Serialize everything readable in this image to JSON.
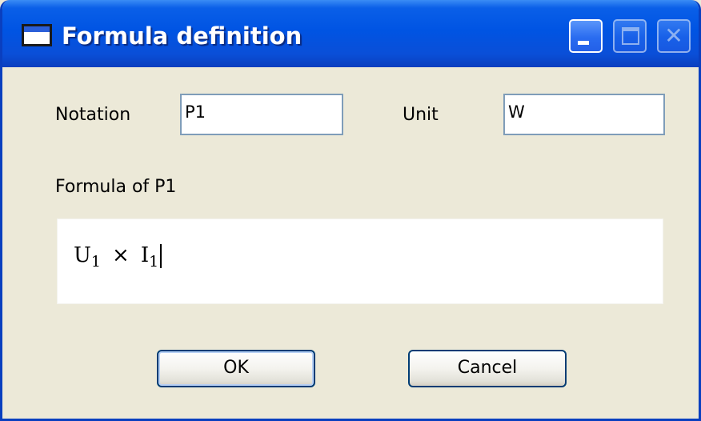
{
  "window": {
    "title": "Formula definition"
  },
  "titlebar_buttons": {
    "minimize_icon": "minimize-icon",
    "maximize_icon": "maximize-icon",
    "close_icon": "close-icon",
    "close_glyph": "✕"
  },
  "fields": {
    "notation_label": "Notation",
    "notation_value": "P1",
    "unit_label": "Unit",
    "unit_value": "W"
  },
  "formula": {
    "label": "Formula of P1",
    "term1_symbol": "U",
    "term1_subscript": "1",
    "operator": "×",
    "term2_symbol": "I",
    "term2_subscript": "1"
  },
  "buttons": {
    "ok_label": "OK",
    "cancel_label": "Cancel"
  },
  "colors": {
    "titlebar": "#0054e3",
    "dialog_background": "#ece9d8",
    "field_border": "#7f9db9",
    "button_border": "#003c74"
  }
}
